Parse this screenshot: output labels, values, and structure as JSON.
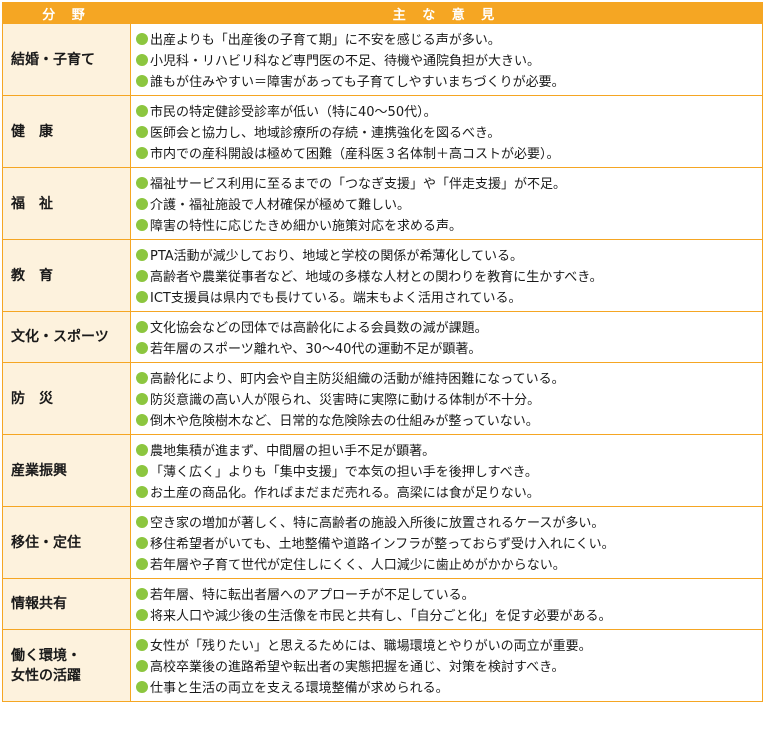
{
  "header": {
    "field": "分 野",
    "opinions": "主 な 意 見"
  },
  "rows": [
    {
      "field": "結婚・子育て",
      "opinions": [
        "出産よりも「出産後の子育て期」に不安を感じる声が多い。",
        "小児科・リハビリ科など専門医の不足、待機や通院負担が大きい。",
        "誰もが住みやすい＝障害があっても子育てしやすいまちづくりが必要。"
      ]
    },
    {
      "field": "健　康",
      "opinions": [
        "市民の特定健診受診率が低い（特に40～50代）。",
        "医師会と協力し、地域診療所の存続・連携強化を図るべき。",
        "市内での産科開設は極めて困難（産科医３名体制＋高コストが必要）。"
      ]
    },
    {
      "field": "福　祉",
      "opinions": [
        "福祉サービス利用に至るまでの「つなぎ支援」や「伴走支援」が不足。",
        "介護・福祉施設で人材確保が極めて難しい。",
        "障害の特性に応じたきめ細かい施策対応を求める声。"
      ]
    },
    {
      "field": "教　育",
      "opinions": [
        "PTA活動が減少しており、地域と学校の関係が希薄化している。",
        "高齢者や農業従事者など、地域の多様な人材との関わりを教育に生かすべき。",
        "ICT支援員は県内でも長けている。端末もよく活用されている。"
      ]
    },
    {
      "field": "文化・スポーツ",
      "opinions": [
        "文化協会などの団体では高齢化による会員数の減が課題。",
        "若年層のスポーツ離れや、30～40代の運動不足が顕著。"
      ]
    },
    {
      "field": "防　災",
      "opinions": [
        "高齢化により、町内会や自主防災組織の活動が維持困難になっている。",
        "防災意識の高い人が限られ、災害時に実際に動ける体制が不十分。",
        "倒木や危険樹木など、日常的な危険除去の仕組みが整っていない。"
      ]
    },
    {
      "field": "産業振興",
      "opinions": [
        "農地集積が進まず、中間層の担い手不足が顕著。",
        "「薄く広く」よりも「集中支援」で本気の担い手を後押しすべき。",
        "お土産の商品化。作ればまだまだ売れる。高梁には食が足りない。"
      ]
    },
    {
      "field": "移住・定住",
      "opinions": [
        "空き家の増加が著しく、特に高齢者の施設入所後に放置されるケースが多い。",
        "移住希望者がいても、土地整備や道路インフラが整っておらず受け入れにくい。",
        "若年層や子育て世代が定住しにくく、人口減少に歯止めがかからない。"
      ]
    },
    {
      "field": "情報共有",
      "opinions": [
        "若年層、特に転出者層へのアプローチが不足している。",
        "将来人口や減少後の生活像を市民と共有し、「自分ごと化」を促す必要がある。"
      ]
    },
    {
      "field": "働く環境・\n女性の活躍",
      "opinions": [
        "女性が「残りたい」と思えるためには、職場環境とやりがいの両立が重要。",
        "高校卒業後の進路希望や転出者の実態把握を通じ、対策を検討すべき。",
        "仕事と生活の両立を支える環境整備が求められる。"
      ]
    }
  ],
  "colors": {
    "header_bg": "#f5a623",
    "field_bg": "#fdf2dd",
    "border": "#f5a623",
    "bullet": "#8cc63f"
  },
  "icons": {
    "bullet": "green-dot-icon"
  }
}
